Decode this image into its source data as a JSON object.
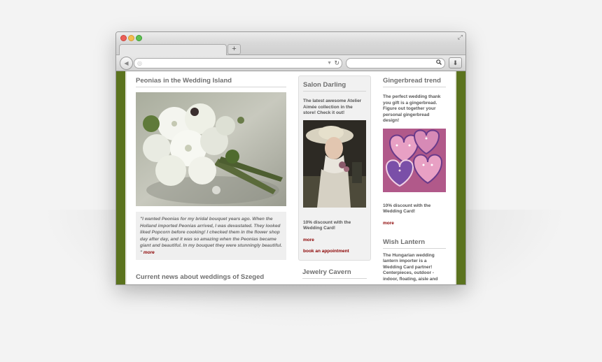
{
  "browser": {
    "url_value": "",
    "search_value": "",
    "new_tab_label": "+"
  },
  "main": {
    "title": "Peonias in the Wedding Island",
    "quote": "\"I wanted Peonias for my bridal bouquet years ago. When the Holland imported Peonias arrived, I was devastated. They looked liked Popcorn before cooking! I checked them in the flower shop day after day, and it was so amazing when the Peonias became giant and beautiful. In my bouquet they were stunningly beautiful. \"",
    "quote_more": "more",
    "news_title": "Current news about weddings of Szeged"
  },
  "salon": {
    "title": "Salon Darling",
    "text": "The latest awesome Atelier Aimée collection in the store! Check it out!",
    "discount": "10% discount with the Wedding Card!",
    "more": "more",
    "appointment": "book an appointment",
    "next_title": "Jewelry Cavern"
  },
  "gingerbread": {
    "title": "Gingerbread trend",
    "text": "The perfect wedding thank you gift is a gingerbread. Figure out together your personal gingerbread design!",
    "discount": "10% discount with the Wedding Card!",
    "more": "more"
  },
  "lantern": {
    "title": "Wish Lantern",
    "text": "The Hungarian wedding lantern importer is a Wedding Card partner! Centerpieces, outdoor - indoor, floating, aisle and"
  },
  "colors": {
    "frame_green": "#5b731e",
    "link_red": "#8b0000"
  }
}
